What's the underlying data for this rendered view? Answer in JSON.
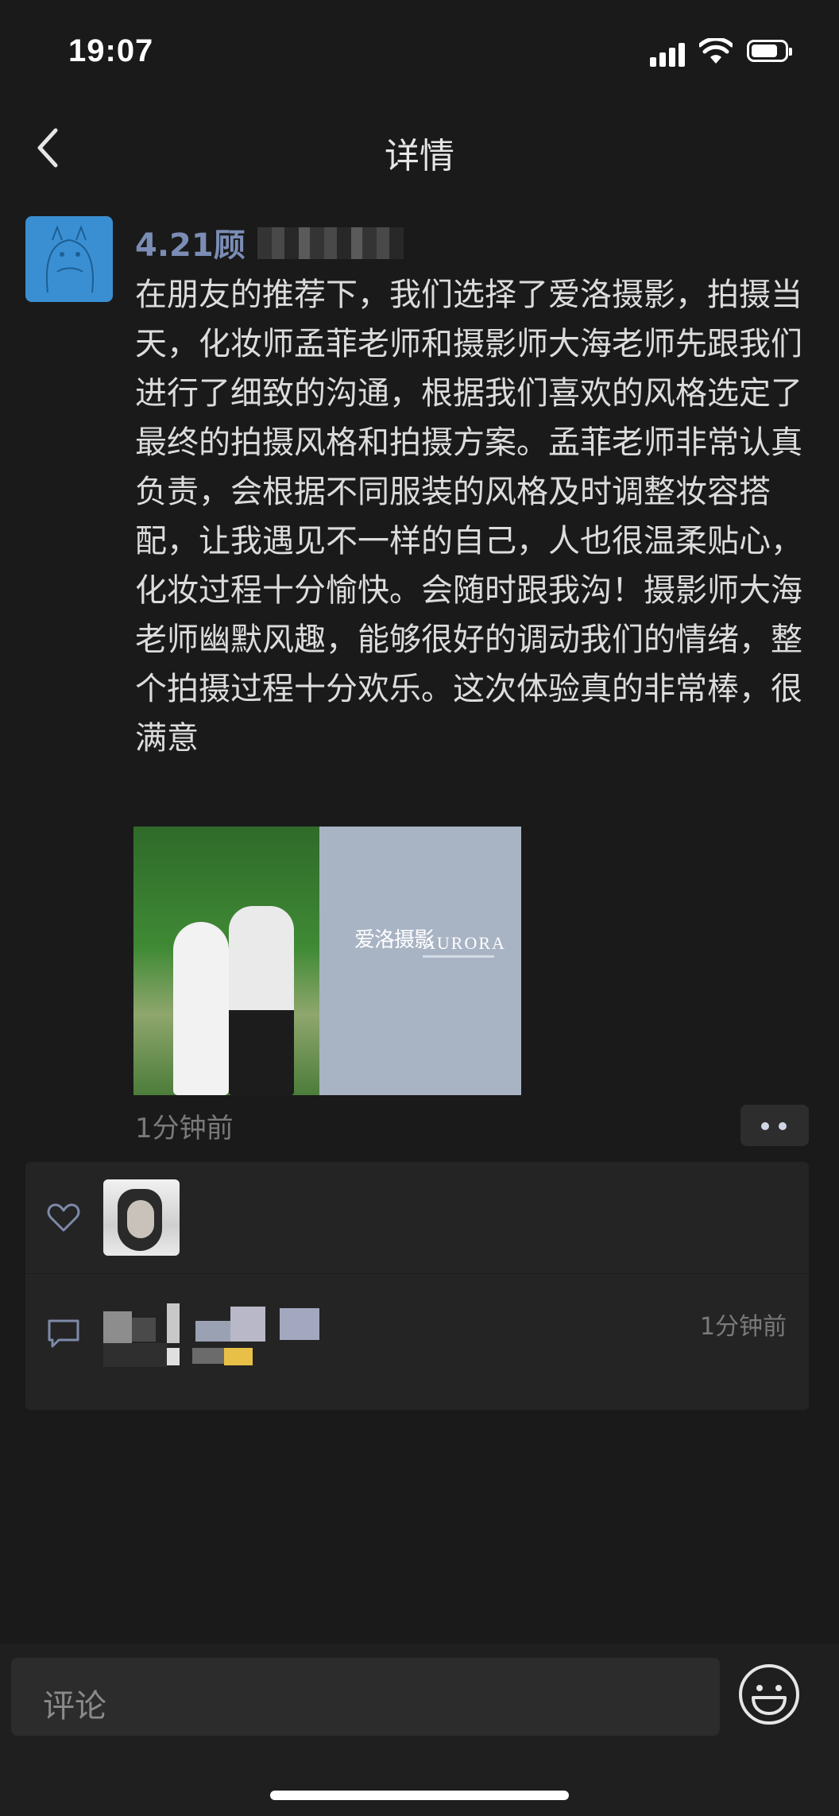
{
  "status_bar": {
    "time": "19:07"
  },
  "nav": {
    "title": "详情"
  },
  "post": {
    "username": "4.21顾",
    "text": "在朋友的推荐下，我们选择了爱洛摄影，拍摄当天，化妆师孟菲老师和摄影师大海老师先跟我们进行了细致的沟通，根据我们喜欢的风格选定了最终的拍摄风格和拍摄方案。孟菲老师非常认真负责，会根据不同服装的风格及时调整妆容搭配，让我遇见不一样的自己，人也很温柔贴心，化妆过程十分愉快。会随时跟我沟！摄影师大海老师幽默风趣，能够很好的调动我们的情绪，整个拍摄过程十分欢乐。这次体验真的非常棒，很满意",
    "photo": {
      "brand_cn": "爱洛摄影",
      "brand_en": "AURORA"
    },
    "time_ago": "1分钟前"
  },
  "interactions": {
    "comment_time": "1分钟前"
  },
  "bottom": {
    "comment_placeholder": "评论"
  },
  "colors": {
    "background": "#1a1a1a",
    "username": "#7b8db5",
    "avatar": "#3a8fd2"
  },
  "icons": [
    "back-icon",
    "heart-icon",
    "comment-icon",
    "emoji-icon",
    "more-icon"
  ]
}
